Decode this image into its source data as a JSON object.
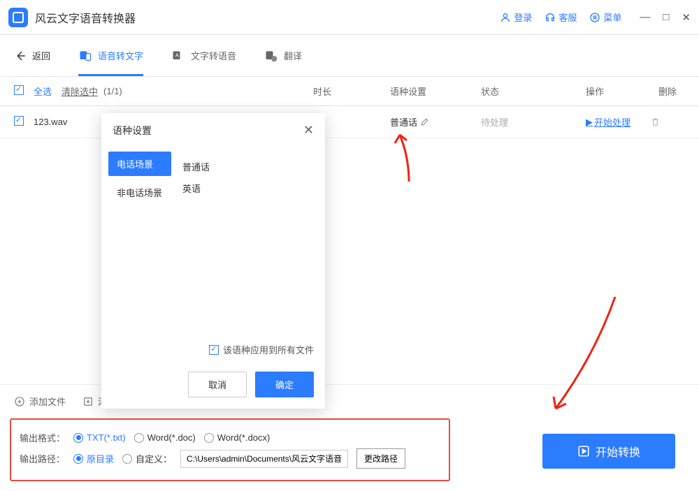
{
  "titlebar": {
    "app_name": "风云文字语音转换器",
    "login": "登录",
    "support": "客服",
    "menu": "菜单"
  },
  "nav": {
    "back": "返回",
    "tab_stt": "语音转文字",
    "tab_tts": "文字转语音",
    "tab_translate": "翻译"
  },
  "table": {
    "select_all": "全选",
    "clear_selection": "清除选中",
    "count": "(1/1)",
    "header_duration": "时长",
    "header_lang": "语种设置",
    "header_status": "状态",
    "header_action": "操作",
    "header_delete": "删除",
    "row": {
      "filename": "123.wav",
      "lang": "普通话",
      "status": "待处理",
      "action": "开始处理"
    }
  },
  "popup": {
    "title": "语种设置",
    "cat_phone": "电话场景",
    "cat_nonphone": "非电话场景",
    "opt_mandarin": "普通话",
    "opt_english": "英语",
    "apply_all": "该语种应用到所有文件",
    "cancel": "取消",
    "confirm": "确定"
  },
  "bottom": {
    "add_file": "添加文件",
    "add_folder": "添加文件夹"
  },
  "output": {
    "format_label": "输出格式：",
    "fmt_txt": "TXT(*.txt)",
    "fmt_doc": "Word(*.doc)",
    "fmt_docx": "Word(*.docx)",
    "path_label": "输出路径：",
    "path_original": "原目录",
    "path_custom": "自定义：",
    "path_value": "C:\\Users\\admin\\Documents\\风云文字语音转",
    "change_path": "更改路径"
  },
  "start_button": "开始转换"
}
